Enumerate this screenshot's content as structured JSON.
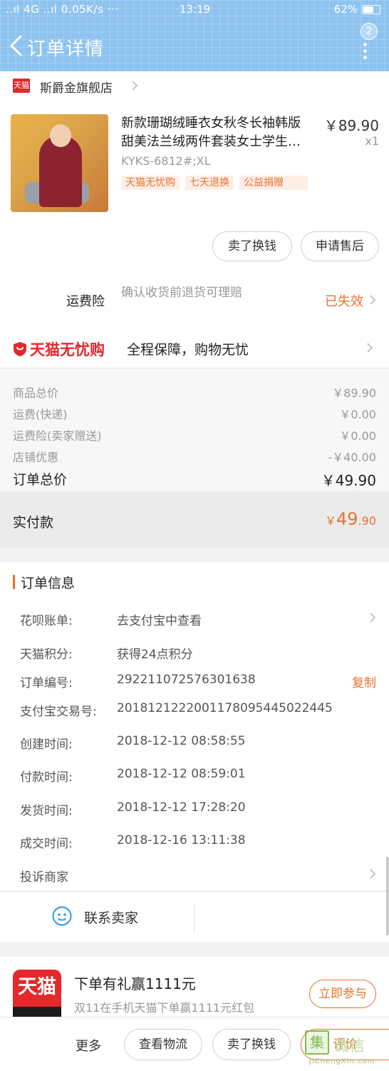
{
  "status_bar": {
    "left": "..ıl 4G ..ıl 0.05K/s ···",
    "time": "13:19",
    "battery": "62%"
  },
  "nav": {
    "title": "订单详情",
    "badge": "2"
  },
  "shop": {
    "logo": "天猫",
    "name": "斯爵金旗舰店"
  },
  "product": {
    "title_line1": "新款珊瑚绒睡衣女秋冬长袖韩版",
    "title_line2": "甜美法兰绒两件套装女士学生…",
    "price": "￥89.90",
    "quantity": "x1",
    "sku": "KYKS-6812#;XL",
    "tags": [
      "天猫无忧购",
      "七天退换",
      "公益捐赠"
    ],
    "button_exchange": "卖了换钱",
    "button_aftersale": "申请售后"
  },
  "insurance": {
    "label": "运费险",
    "description": "确认收货前退货可理赔",
    "status": "已失效"
  },
  "guarantee": {
    "brand": "天猫无忧购",
    "text": "全程保障，购物无忧"
  },
  "summary": {
    "rows": [
      {
        "label": "商品总价",
        "value": "￥89.90"
      },
      {
        "label": "运费(快递)",
        "value": "￥0.00"
      },
      {
        "label": "运费险(卖家赠送)",
        "value": "￥0.00"
      },
      {
        "label": "店铺优惠",
        "value": "-￥40.00"
      }
    ],
    "total_label": "订单总价",
    "total_value": "￥49.90",
    "paid_label": "实付款",
    "paid_symbol": "￥",
    "paid_int": "49",
    "paid_dec": ".90"
  },
  "order_info": {
    "title": "订单信息",
    "rows": [
      {
        "key": "花呗账单:",
        "value": "去支付宝中查看"
      },
      {
        "key": "天猫积分:",
        "value": "获得24点积分"
      },
      {
        "key": "订单编号:",
        "value": "292211072576301638",
        "action": "复制"
      },
      {
        "key": "支付宝交易号:",
        "value": "2018121222001178095445022445"
      },
      {
        "key": "创建时间:",
        "value": "2018-12-12 08:58:55"
      },
      {
        "key": "付款时间:",
        "value": "2018-12-12 08:59:01"
      },
      {
        "key": "发货时间:",
        "value": "2018-12-12 17:28:20"
      },
      {
        "key": "成交时间:",
        "value": "2018-12-16 13:11:38"
      },
      {
        "key": "投诉商家",
        "value": ""
      }
    ]
  },
  "contact": {
    "label": "联系卖家"
  },
  "promo": {
    "logo": "天猫",
    "title": "下单有礼赢1111元",
    "subtitle": "双11在手机天猫下单赢1111元红包",
    "button": "立即参与"
  },
  "bottom_bar": {
    "more": "更多",
    "logistics": "查看物流",
    "exchange": "卖了换钱",
    "review": "评价"
  },
  "watermark": {
    "box": "集",
    "text": "诚信",
    "url": "JiChengXin.com"
  },
  "colors": {
    "header": "#8ec3f0",
    "accent_orange": "#e8722f",
    "tmall_red": "#e4282b"
  }
}
